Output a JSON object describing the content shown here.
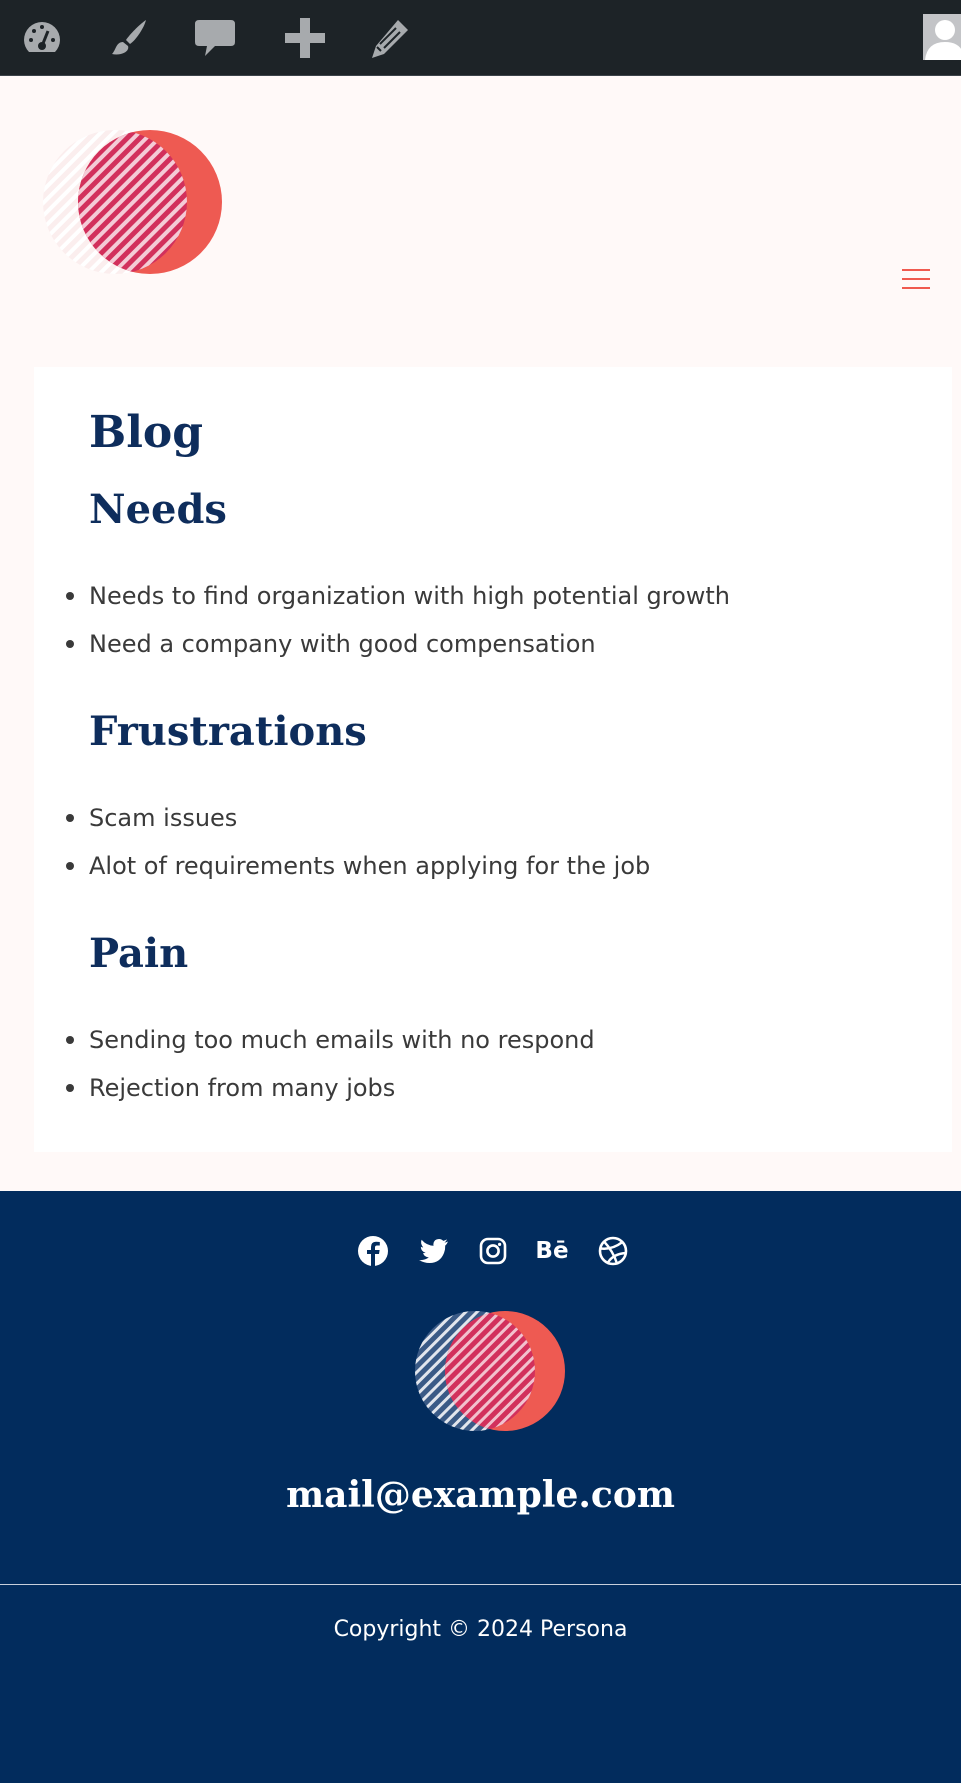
{
  "admin_bar": {
    "icons": [
      "dashboard-icon",
      "customize-brush-icon",
      "comments-icon",
      "new-content-plus-icon",
      "edit-pencil-icon",
      "user-avatar-icon"
    ]
  },
  "header": {
    "logo": "site-logo-circles",
    "menu_icon": "hamburger-menu-icon"
  },
  "content": {
    "page_title": "Blog",
    "sections": [
      {
        "heading": "Needs",
        "items": [
          "Needs to find organization with high potential growth",
          "Need a company with good compensation"
        ]
      },
      {
        "heading": "Frustrations",
        "items": [
          "Scam issues",
          "Alot of requirements when applying for the job"
        ]
      },
      {
        "heading": "Pain",
        "items": [
          "Sending too much emails with no respond",
          "Rejection from many jobs"
        ]
      }
    ]
  },
  "footer": {
    "social_icons": [
      "facebook-icon",
      "twitter-icon",
      "instagram-icon",
      "behance-icon",
      "dribbble-icon"
    ],
    "behance_label": "Bē",
    "email": "mail@example.com",
    "copyright": "Copyright © 2024 Persona"
  },
  "colors": {
    "admin_bar_bg": "#1d2327",
    "page_bg": "#fff9f8",
    "heading": "#0e2d5c",
    "accent": "#f05a4f",
    "footer_bg": "#022c5d",
    "body_text": "#3a3a3a"
  }
}
